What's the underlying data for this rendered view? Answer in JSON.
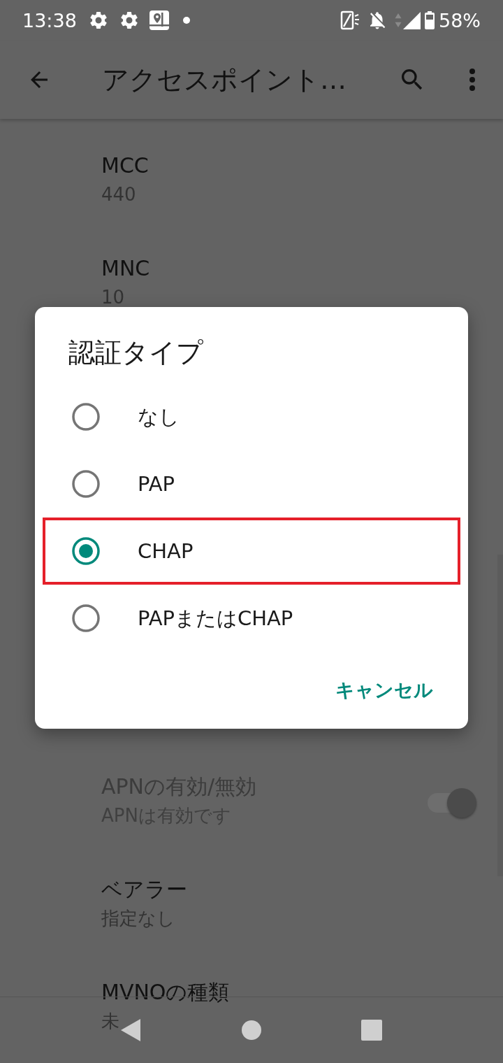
{
  "status_bar": {
    "time": "13:38",
    "battery": "58%"
  },
  "toolbar": {
    "title": "アクセスポイント…"
  },
  "settings": [
    {
      "kind": "text",
      "title": "MCC",
      "summary": "440",
      "disabled": false
    },
    {
      "kind": "text",
      "title": "MNC",
      "summary": "10",
      "disabled": false
    },
    {
      "kind": "switch",
      "title": "APNの有効/無効",
      "summary": "APNは有効です",
      "disabled": true,
      "on": true
    },
    {
      "kind": "text",
      "title": "ベアラー",
      "summary": "指定なし",
      "disabled": false
    },
    {
      "kind": "text",
      "title": "MVNOの種類",
      "summary": "未",
      "disabled": false
    }
  ],
  "dialog": {
    "title": "認証タイプ",
    "options": [
      {
        "label": "なし",
        "selected": false,
        "highlighted": false
      },
      {
        "label": "PAP",
        "selected": false,
        "highlighted": false
      },
      {
        "label": "CHAP",
        "selected": true,
        "highlighted": true
      },
      {
        "label": "PAPまたはCHAP",
        "selected": false,
        "highlighted": false
      }
    ],
    "buttons": [
      "キャンセル"
    ]
  }
}
